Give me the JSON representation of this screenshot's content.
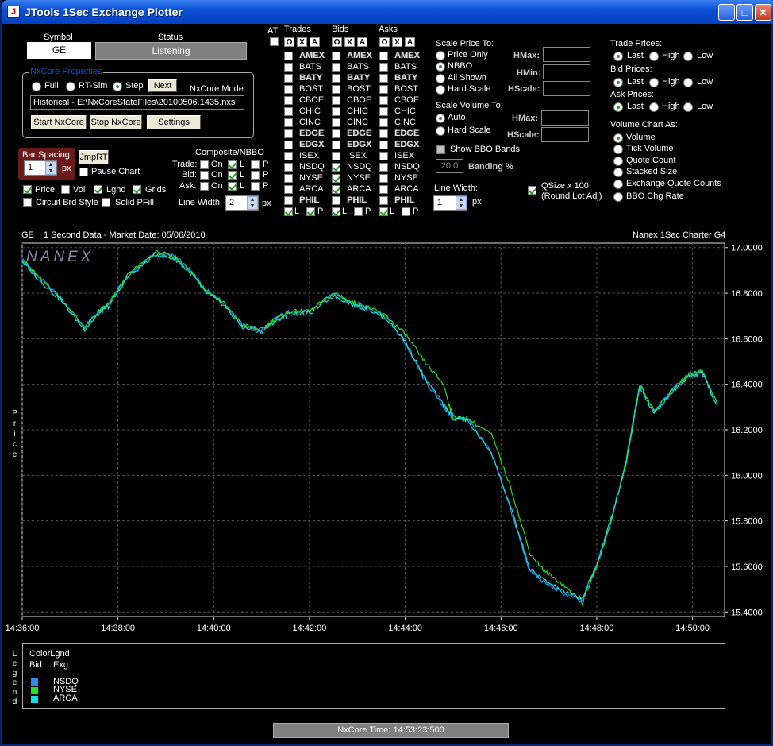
{
  "window": {
    "title": "JTools 1Sec Exchange Plotter",
    "min": "_",
    "max": "□",
    "close": "✕"
  },
  "symbol": {
    "label": "Symbol",
    "value": "GE"
  },
  "status": {
    "label": "Status",
    "value": "Listening"
  },
  "nxcore": {
    "group_label": "NxCore Properties",
    "modes": [
      "Full",
      "RT-Sim",
      "Step"
    ],
    "selected_mode": "Step",
    "next_button": "Next",
    "mode_label": "NxCore Mode:",
    "mode_value": "Historical - E:\\NxCoreStateFiles\\20100506.1435.nxs",
    "start_button": "Start NxCore",
    "stop_button": "Stop NxCore",
    "settings_button": "Settings"
  },
  "bar": {
    "label": "Bar Spacing:",
    "value": "1",
    "unit": "px",
    "jmp_button": "JmpRT",
    "pause_label": "Pause Chart"
  },
  "display_options": [
    {
      "label": "Price",
      "checked": true
    },
    {
      "label": "Vol",
      "checked": false
    },
    {
      "label": "Lgnd",
      "checked": true
    },
    {
      "label": "Grids",
      "checked": true
    },
    {
      "label": "Circuit Brd Style",
      "checked": false
    },
    {
      "label": "Solid PFill",
      "checked": false
    }
  ],
  "composite": {
    "title": "Composite/NBBO",
    "rows": [
      {
        "label": "Trade:",
        "on": "On",
        "l": "L",
        "p": "P",
        "l_checked": true
      },
      {
        "label": "Bid:",
        "on": "On",
        "l": "L",
        "p": "P",
        "l_checked": true
      },
      {
        "label": "Ask:",
        "on": "On",
        "l": "L",
        "p": "P",
        "l_checked": true
      }
    ],
    "line_width_label": "Line Width:",
    "line_width": "2",
    "unit": "px"
  },
  "exchanges": {
    "at_label": "AT",
    "trades_label": "Trades",
    "bids_label": "Bids",
    "asks_label": "Asks",
    "oxa": [
      "O",
      "X",
      "A"
    ],
    "names": [
      "AMEX",
      "BATS",
      "BATY",
      "BOST",
      "CBOE",
      "CHIC",
      "CINC",
      "EDGE",
      "EDGX",
      "ISEX",
      "NSDQ",
      "NYSE",
      "ARCA",
      "PHIL"
    ],
    "bids_checked": [
      "NSDQ",
      "NYSE",
      "ARCA"
    ],
    "l_label": "L",
    "p_label": "P"
  },
  "scale_price": {
    "title": "Scale Price To:",
    "options": [
      "Price Only",
      "NBBO",
      "All Shown",
      "Hard Scale"
    ],
    "selected": "NBBO",
    "hmax": "HMax:",
    "hmin": "HMin:",
    "hscale": "HScale:"
  },
  "scale_volume": {
    "title": "Scale Volume To:",
    "options": [
      "Auto",
      "Hard Scale"
    ],
    "selected": "Auto",
    "hmax": "HMax:",
    "hscale": "HScale:",
    "show_bbo": "Show BBO Bands",
    "banding_value": "20.0",
    "banding_label": "Banding %",
    "line_width_label": "Line Width:",
    "line_width": "1",
    "unit": "px"
  },
  "qsize": {
    "label1": "QSize x 100",
    "label2": "(Round Lot Adj)",
    "checked": true
  },
  "trade_prices": {
    "title": "Trade Prices:",
    "options": [
      "Last",
      "High",
      "Low"
    ],
    "selected": "Last"
  },
  "bid_prices": {
    "title": "Bid Prices:",
    "options": [
      "Last",
      "High",
      "Low"
    ],
    "selected": "Last"
  },
  "ask_prices": {
    "title": "Ask Prices:",
    "options": [
      "Last",
      "High",
      "Low"
    ],
    "selected": "Last"
  },
  "volume_chart": {
    "title": "Volume Chart As:",
    "options": [
      "Volume",
      "Tick Volume",
      "Quote Count",
      "Stacked Size",
      "Exchange Quote Counts",
      "BBO Chg Rate"
    ],
    "selected": "Volume"
  },
  "chart_header": {
    "symbol": "GE",
    "description": "1 Second Data - Market Date: 05/06/2010",
    "brand": "Nanex 1Sec Charter G4"
  },
  "chart_data": {
    "type": "line",
    "watermark": "NANEX",
    "ylabel": "Price",
    "x_ticks": [
      "14:36:00",
      "14:38:00",
      "14:40:00",
      "14:42:00",
      "14:44:00",
      "14:46:00",
      "14:48:00",
      "14:50:00"
    ],
    "y_ticks": [
      "17.0000",
      "16.8000",
      "16.6000",
      "16.4000",
      "16.2000",
      "16.0000",
      "15.8000",
      "15.6000",
      "15.4000"
    ],
    "ylim": [
      15.38,
      17.02
    ],
    "x_range_minutes": [
      0,
      14.67
    ],
    "grid": true,
    "series": [
      {
        "name": "NSDQ",
        "color": "#2d8cf0",
        "x": [
          0,
          0.3,
          0.8,
          1.3,
          1.6,
          1.8,
          2.2,
          2.8,
          3.2,
          3.6,
          3.8,
          4.2,
          4.6,
          5.0,
          5.3,
          5.6,
          6.0,
          6.5,
          6.9,
          7.2,
          7.6,
          8.0,
          8.4,
          8.8,
          9.0,
          9.3,
          9.8,
          10.2,
          10.6,
          10.9,
          11.3,
          11.7,
          12.0,
          12.3,
          12.6,
          12.9,
          13.2,
          13.6,
          13.9,
          14.2,
          14.5
        ],
        "y": [
          16.95,
          16.88,
          16.78,
          16.65,
          16.72,
          16.75,
          16.88,
          16.98,
          16.96,
          16.88,
          16.82,
          16.76,
          16.66,
          16.64,
          16.69,
          16.72,
          16.72,
          16.8,
          16.76,
          16.74,
          16.7,
          16.58,
          16.42,
          16.3,
          16.25,
          16.25,
          16.1,
          15.85,
          15.58,
          15.53,
          15.48,
          15.45,
          15.6,
          15.8,
          16.05,
          16.4,
          16.28,
          16.38,
          16.44,
          16.46,
          16.32
        ]
      },
      {
        "name": "NYSE",
        "color": "#22e022",
        "x": [
          0,
          0.3,
          0.8,
          1.3,
          1.6,
          1.8,
          2.2,
          2.8,
          3.2,
          3.6,
          3.8,
          4.2,
          4.6,
          5.0,
          5.3,
          5.6,
          6.0,
          6.5,
          6.9,
          7.2,
          7.6,
          8.0,
          8.4,
          8.8,
          9.0,
          9.3,
          9.8,
          10.2,
          10.6,
          10.9,
          11.3,
          11.7,
          12.0,
          12.3,
          12.6,
          12.9,
          13.2,
          13.6,
          13.9,
          14.2,
          14.5
        ],
        "y": [
          16.95,
          16.88,
          16.78,
          16.65,
          16.72,
          16.75,
          16.88,
          16.98,
          16.96,
          16.88,
          16.82,
          16.76,
          16.66,
          16.64,
          16.69,
          16.72,
          16.72,
          16.8,
          16.76,
          16.74,
          16.7,
          16.62,
          16.5,
          16.4,
          16.25,
          16.25,
          16.18,
          15.95,
          15.66,
          15.58,
          15.52,
          15.44,
          15.6,
          15.8,
          16.05,
          16.4,
          16.28,
          16.38,
          16.44,
          16.46,
          16.32
        ]
      },
      {
        "name": "ARCA",
        "color": "#10e0e0",
        "x": [
          0,
          0.3,
          0.8,
          1.3,
          1.6,
          1.8,
          2.2,
          2.8,
          3.2,
          3.6,
          3.8,
          4.2,
          4.6,
          5.0,
          5.3,
          5.6,
          6.0,
          6.5,
          6.9,
          7.2,
          7.6,
          8.0,
          8.4,
          8.8,
          9.0,
          9.3,
          9.8,
          10.2,
          10.6,
          10.9,
          11.3,
          11.7,
          12.0,
          12.3,
          12.6,
          12.9,
          13.2,
          13.6,
          13.9,
          14.2,
          14.5
        ],
        "y": [
          16.94,
          16.87,
          16.77,
          16.64,
          16.71,
          16.74,
          16.87,
          16.97,
          16.95,
          16.87,
          16.81,
          16.75,
          16.65,
          16.63,
          16.68,
          16.71,
          16.71,
          16.79,
          16.75,
          16.73,
          16.69,
          16.59,
          16.43,
          16.31,
          16.26,
          16.24,
          16.1,
          15.86,
          15.59,
          15.54,
          15.49,
          15.46,
          15.61,
          15.81,
          16.04,
          16.39,
          16.27,
          16.37,
          16.43,
          16.45,
          16.31
        ]
      }
    ]
  },
  "legend": {
    "side_label": "Legend",
    "title": "ColorLgnd",
    "col1": "Bid",
    "col2": "Exg",
    "entries": [
      {
        "name": "NSDQ",
        "color": "#2d8cf0"
      },
      {
        "name": "NYSE",
        "color": "#22e022"
      },
      {
        "name": "ARCA",
        "color": "#10e0e0"
      }
    ]
  },
  "footer": {
    "time": "NxCore Time: 14:53:23:500"
  }
}
